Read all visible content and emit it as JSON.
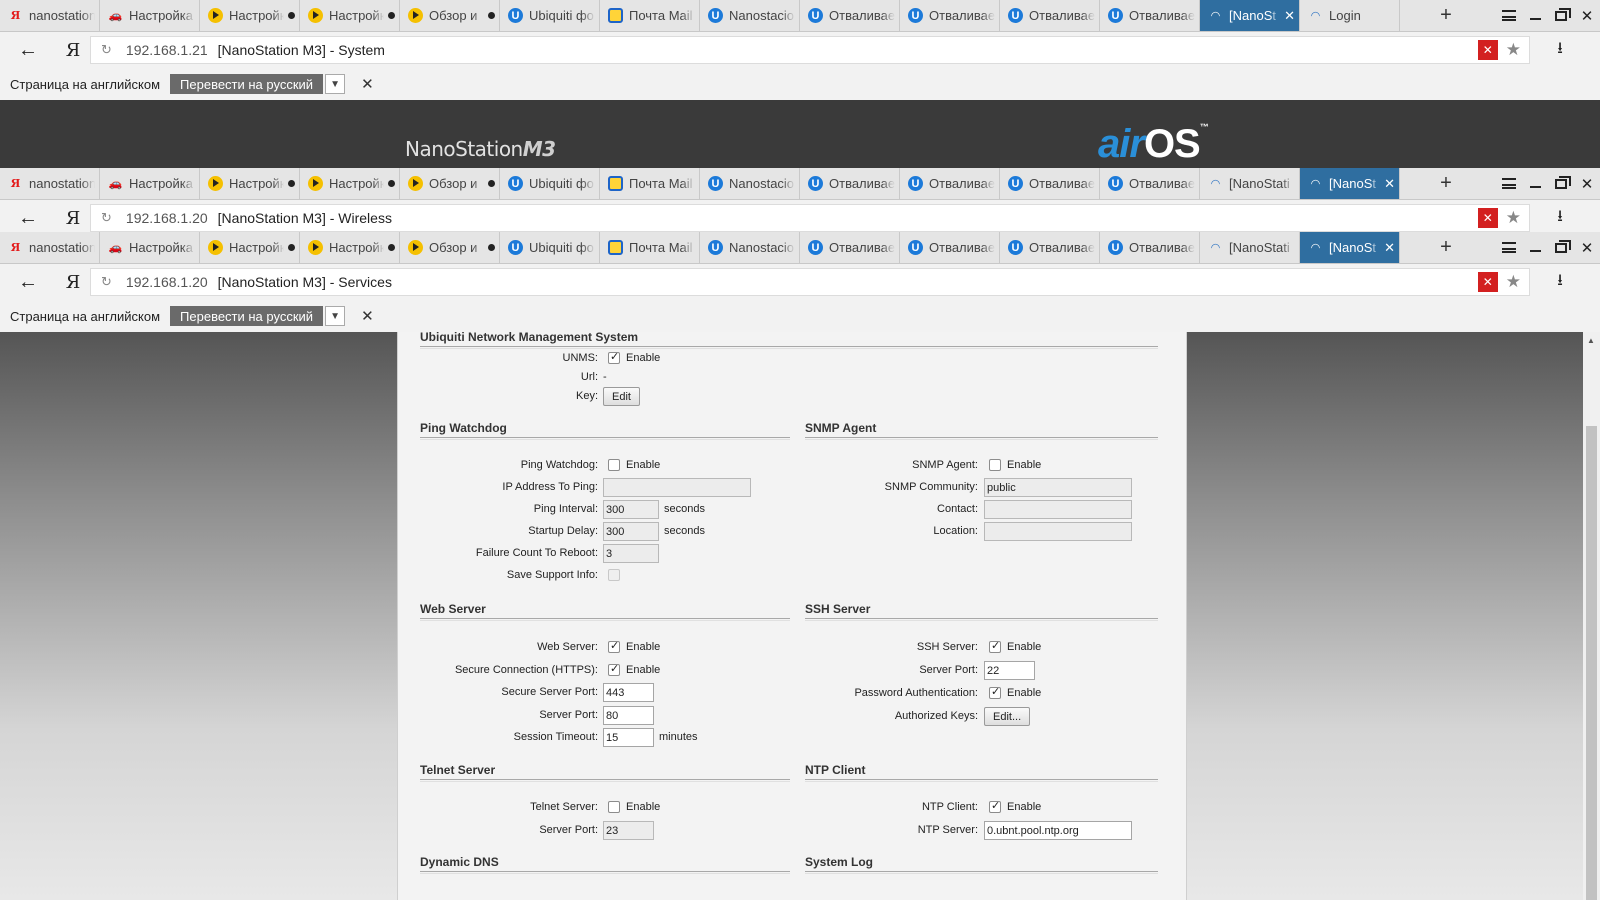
{
  "tabs_set_1": [
    {
      "icon": "yandex",
      "label": "nanostation"
    },
    {
      "icon": "car",
      "label": "Настройка"
    },
    {
      "icon": "play",
      "label": "Настройка",
      "dot": true
    },
    {
      "icon": "play",
      "label": "Настройка",
      "dot": true
    },
    {
      "icon": "play",
      "label": "Обзор и",
      "dot": true
    },
    {
      "icon": "ubiquiti",
      "label": "Ubiquiti фо"
    },
    {
      "icon": "mail",
      "label": "Почта Mail"
    },
    {
      "icon": "ubiquiti",
      "label": "Nanostacio"
    },
    {
      "icon": "ubiquiti",
      "label": "Отваливае"
    },
    {
      "icon": "ubiquiti",
      "label": "Отваливае"
    },
    {
      "icon": "ubiquiti",
      "label": "Отваливае"
    },
    {
      "icon": "ubiquiti",
      "label": "Отваливае"
    },
    {
      "icon": "wifi",
      "label": "[NanoSt",
      "active": true,
      "close": true
    },
    {
      "icon": "wifi",
      "label": "Login"
    }
  ],
  "tabs_set_2": [
    {
      "icon": "yandex",
      "label": "nanostation"
    },
    {
      "icon": "car",
      "label": "Настройка"
    },
    {
      "icon": "play",
      "label": "Настройка",
      "dot": true
    },
    {
      "icon": "play",
      "label": "Настройка",
      "dot": true
    },
    {
      "icon": "play",
      "label": "Обзор и",
      "dot": true
    },
    {
      "icon": "ubiquiti",
      "label": "Ubiquiti фо"
    },
    {
      "icon": "mail",
      "label": "Почта Mail"
    },
    {
      "icon": "ubiquiti",
      "label": "Nanostacio"
    },
    {
      "icon": "ubiquiti",
      "label": "Отваливае"
    },
    {
      "icon": "ubiquiti",
      "label": "Отваливае"
    },
    {
      "icon": "ubiquiti",
      "label": "Отваливае"
    },
    {
      "icon": "ubiquiti",
      "label": "Отваливае"
    },
    {
      "icon": "wifi",
      "label": "[NanoStati"
    },
    {
      "icon": "wifi",
      "label": "[NanoSt",
      "active": true,
      "close": true
    }
  ],
  "window1": {
    "host": "192.168.1.21",
    "title": "[NanoStation M3] - System"
  },
  "window2": {
    "host": "192.168.1.20",
    "title": "[NanoStation M3] - Wireless"
  },
  "window3": {
    "host": "192.168.1.20",
    "title": "[NanoStation M3] - Services"
  },
  "translate": {
    "lang_text": "Страница на английском",
    "button": "Перевести на русский"
  },
  "airos_header": {
    "model_prefix": "NanoStation",
    "model_suffix": "M3",
    "brand_air": "air",
    "brand_os": "OS",
    "brand_tm": "™"
  },
  "services": {
    "unms": {
      "title": "Ubiquiti Network Management System",
      "unms_label": "UNMS:",
      "unms_enable": "Enable",
      "url_label": "Url:",
      "url_value": "-",
      "key_label": "Key:",
      "key_button": "Edit"
    },
    "ping_watchdog": {
      "title": "Ping Watchdog",
      "enable_label": "Ping Watchdog:",
      "enable_text": "Enable",
      "ip_label": "IP Address To Ping:",
      "ip_value": "",
      "interval_label": "Ping Interval:",
      "interval_value": "300",
      "interval_unit": "seconds",
      "startup_label": "Startup Delay:",
      "startup_value": "300",
      "startup_unit": "seconds",
      "failure_label": "Failure Count To Reboot:",
      "failure_value": "3",
      "support_label": "Save Support Info:"
    },
    "snmp": {
      "title": "SNMP Agent",
      "agent_label": "SNMP Agent:",
      "agent_enable": "Enable",
      "community_label": "SNMP Community:",
      "community_value": "public",
      "contact_label": "Contact:",
      "contact_value": "",
      "location_label": "Location:",
      "location_value": ""
    },
    "web_server": {
      "title": "Web Server",
      "server_label": "Web Server:",
      "server_enable": "Enable",
      "https_label": "Secure Connection (HTTPS):",
      "https_enable": "Enable",
      "secure_port_label": "Secure Server Port:",
      "secure_port_value": "443",
      "port_label": "Server Port:",
      "port_value": "80",
      "timeout_label": "Session Timeout:",
      "timeout_value": "15",
      "timeout_unit": "minutes"
    },
    "ssh_server": {
      "title": "SSH Server",
      "server_label": "SSH Server:",
      "server_enable": "Enable",
      "port_label": "Server Port:",
      "port_value": "22",
      "password_label": "Password Authentication:",
      "password_enable": "Enable",
      "keys_label": "Authorized Keys:",
      "keys_button": "Edit..."
    },
    "telnet": {
      "title": "Telnet Server",
      "server_label": "Telnet Server:",
      "server_enable": "Enable",
      "port_label": "Server Port:",
      "port_value": "23"
    },
    "ntp": {
      "title": "NTP Client",
      "client_label": "NTP Client:",
      "client_enable": "Enable",
      "server_label": "NTP Server:",
      "server_value": "0.ubnt.pool.ntp.org"
    },
    "ddns": {
      "title": "Dynamic DNS"
    },
    "syslog": {
      "title": "System Log"
    }
  }
}
